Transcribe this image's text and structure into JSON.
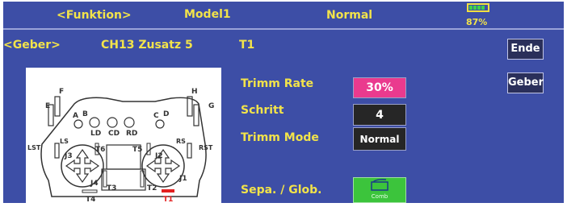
{
  "header": {
    "function_label": "<Funktion>",
    "model_label": "Model1",
    "mode_label": "Normal",
    "battery_percent": "87%",
    "battery_level": 0.87
  },
  "row": {
    "geber_label": "<Geber>",
    "channel_label": "CH13 Zusatz 5",
    "trim_label": "T1"
  },
  "buttons": {
    "ende": "Ende",
    "geber": "Geber"
  },
  "settings": {
    "trimm_rate_label": "Trimm Rate",
    "trimm_rate_value": "30%",
    "schritt_label": "Schritt",
    "schritt_value": "4",
    "trimm_mode_label": "Trimm Mode",
    "trimm_mode_value": "Normal",
    "sepa_label": "Sepa. / Glob.",
    "sepa_button_sub": "Comb"
  },
  "diagram": {
    "labels": {
      "e": "E",
      "f": "F",
      "a": "A",
      "b": "B",
      "h": "H",
      "g": "G",
      "c": "C",
      "d": "D",
      "ld": "LD",
      "cd": "CD",
      "rd": "RD",
      "lst": "LST",
      "ls": "LS",
      "rs": "RS",
      "rst": "RST",
      "t6": "T6",
      "t5": "T5",
      "j3": "J3",
      "j2": "J2",
      "j4": "J4",
      "j1": "J1",
      "t3": "T3",
      "t2": "T2",
      "t4": "T4",
      "t1": "T1"
    },
    "colors": {
      "highlight": "#e32020",
      "line": "#333333"
    }
  },
  "colors": {
    "background": "#3d4ea6",
    "header_text": "#f2e34a",
    "trimm_rate_bg": "#ea3a8e",
    "value_bg": "#262626",
    "sepa_bg": "#3cc43c"
  }
}
